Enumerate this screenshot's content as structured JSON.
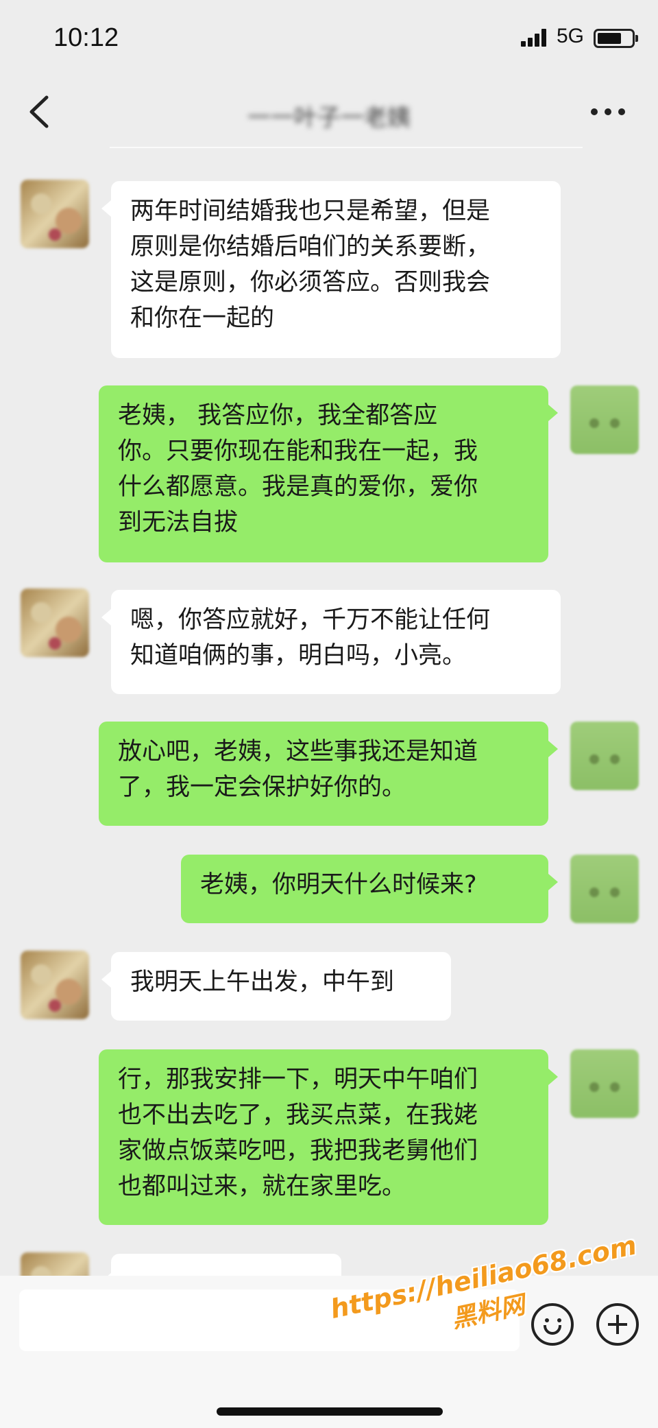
{
  "status_bar": {
    "time": "10:12",
    "network": "5G",
    "battery_level": 0.7
  },
  "nav": {
    "title": "一一叶子一老姨"
  },
  "messages": [
    {
      "side": "in",
      "text": "两年时间结婚我也只是希望，但是\n原则是你结婚后咱们的关系要断，\n这是原则，你必须答应。否则我会\n和你在一起的"
    },
    {
      "side": "out",
      "text": "老姨， 我答应你，我全都答应\n你。只要你现在能和我在一起，我\n什么都愿意。我是真的爱你，爱你\n到无法自拔"
    },
    {
      "side": "in",
      "text": "嗯，你答应就好，千万不能让任何\n知道咱俩的事，明白吗，小亮。"
    },
    {
      "side": "out",
      "text": "放心吧，老姨，这些事我还是知道\n了，我一定会保护好你的。"
    },
    {
      "side": "out",
      "text": "老姨，你明天什么时候来?"
    },
    {
      "side": "in",
      "text": "我明天上午出发，中午到"
    },
    {
      "side": "out",
      "text": "行，那我安排一下，明天中午咱们\n也不出去吃了，我买点菜，在我姥\n家做点饭菜吃吧，我把我老舅他们\n也都叫过来，就在家里吃。"
    },
    {
      "side": "in",
      "text": ""
    }
  ],
  "watermark": {
    "line1": "https://heiliao68.com",
    "line2": "黑料网"
  },
  "icons": [
    "back-arrow-icon",
    "more-dots-icon",
    "emoji-icon",
    "plus-icon",
    "signal-icon",
    "battery-icon"
  ]
}
